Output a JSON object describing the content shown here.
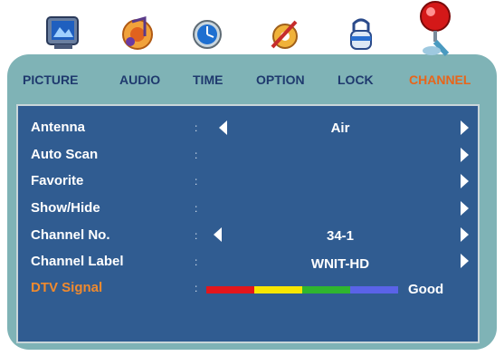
{
  "tabs": [
    {
      "label": "PICTURE",
      "icon": "picture-icon"
    },
    {
      "label": "AUDIO",
      "icon": "audio-icon"
    },
    {
      "label": "TIME",
      "icon": "time-icon"
    },
    {
      "label": "OPTION",
      "icon": "option-icon"
    },
    {
      "label": "LOCK",
      "icon": "lock-icon"
    },
    {
      "label": "CHANNEL",
      "icon": "channel-icon",
      "active": true
    }
  ],
  "rows": [
    {
      "label": "Antenna",
      "colon": ":",
      "value": "Air",
      "left_arrow": true,
      "right_arrow": true
    },
    {
      "label": "Auto Scan",
      "colon": ":",
      "value": "",
      "left_arrow": false,
      "right_arrow": true
    },
    {
      "label": "Favorite",
      "colon": ":",
      "value": "",
      "left_arrow": false,
      "right_arrow": true
    },
    {
      "label": "Show/Hide",
      "colon": ":",
      "value": "",
      "left_arrow": false,
      "right_arrow": true
    },
    {
      "label": "Channel No.",
      "colon": ":",
      "value": "34-1",
      "left_arrow": true,
      "right_arrow": true
    },
    {
      "label": "Channel Label",
      "colon": ":",
      "value": "WNIT-HD",
      "left_arrow": false,
      "right_arrow": true
    },
    {
      "label": "DTV Signal",
      "colon": ":",
      "value": "",
      "active": true
    }
  ],
  "signal": {
    "strength": 1.0,
    "text": "Good",
    "colors": [
      "#e3161c",
      "#f7e600",
      "#2fb52f",
      "#5a63e8"
    ]
  },
  "colors": {
    "panel": "#305c91",
    "frame": "#7fb3b6",
    "tab_text": "#1f3a6e",
    "tab_active": "#e8651a",
    "row_active": "#f08a2e"
  }
}
